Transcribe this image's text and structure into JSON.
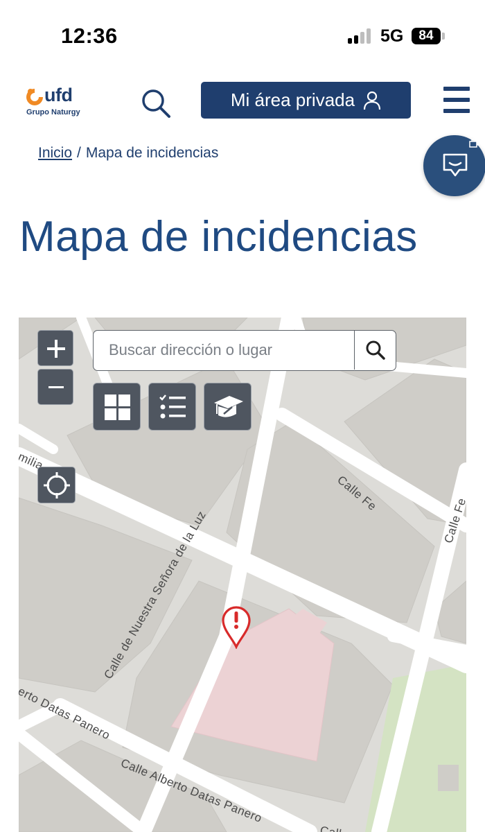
{
  "status_bar": {
    "time": "12:36",
    "network": "5G",
    "battery": "84"
  },
  "header": {
    "logo_text": "ufd",
    "logo_subtitle": "Grupo Naturgy",
    "search_icon": "search-icon",
    "private_area_label": "Mi área privada",
    "user_icon": "user-icon",
    "menu_icon": "hamburger-menu-icon"
  },
  "breadcrumb": {
    "home": "Inicio",
    "separator": "/",
    "current": "Mapa de incidencias"
  },
  "page": {
    "title": "Mapa de incidencias"
  },
  "chat": {
    "icon": "chat-bubble-icon"
  },
  "map": {
    "search_placeholder": "Buscar dirección o lugar",
    "controls": {
      "zoom_in": "+",
      "zoom_out": "−",
      "grid_icon": "basemap-grid-icon",
      "list_icon": "legend-list-icon",
      "layers_icon": "education-layer-icon",
      "locate_icon": "locate-target-icon"
    },
    "streets": {
      "milia": "milia",
      "calle_fe": "Calle Fe",
      "calle_fe_2": "Calle Fe",
      "nuestra_senora": "Calle de Nuestra Señora de la Luz",
      "alberto_1": "erto Datas Panero",
      "alberto_2": "Calle Alberto Datas Panero",
      "calle_cut": "Call"
    },
    "incident_marker": "incident-alert-pin-icon",
    "colors": {
      "block": "#cfcdc8",
      "road": "#ffffff",
      "incident_area": "#ecd2d4",
      "park": "#d4e3c3",
      "pin": "#d82a2a"
    }
  },
  "colors": {
    "brand_blue": "#1f3e6e",
    "brand_orange": "#f08a24",
    "chat_fab": "#2a4f7c"
  }
}
